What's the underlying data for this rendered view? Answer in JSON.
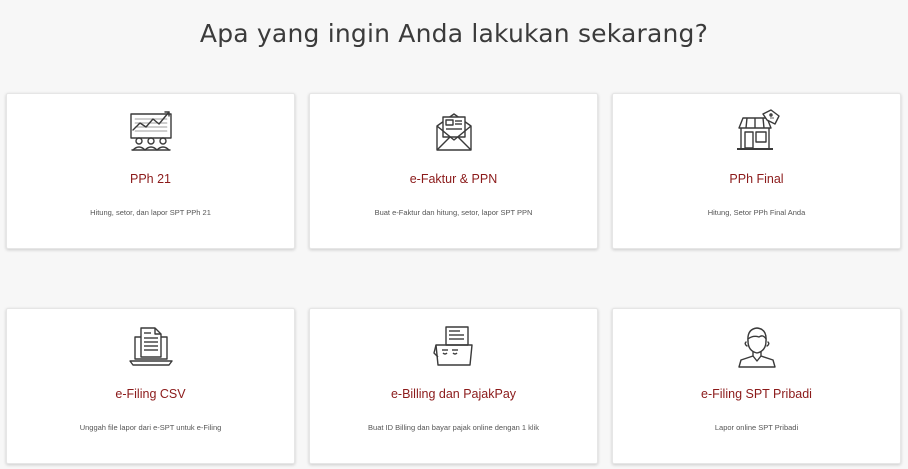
{
  "heading": "Apa yang ingin Anda lakukan sekarang?",
  "colors": {
    "title": "#8b1a1a",
    "icon_stroke": "#3a3a3a",
    "background": "#f7f7f7",
    "card": "#ffffff"
  },
  "cards": [
    {
      "icon": "chart-people-icon",
      "title": "PPh 21",
      "description": "Hitung, setor, dan lapor SPT PPh 21"
    },
    {
      "icon": "envelope-document-icon",
      "title": "e-Faktur & PPN",
      "description": "Buat e-Faktur dan hitung, setor, lapor SPT PPN"
    },
    {
      "icon": "storefront-tag-icon",
      "title": "PPh Final",
      "description": "Hitung, Setor PPh Final Anda"
    },
    {
      "icon": "laptop-document-icon",
      "title": "e-Filing CSV",
      "description": "Unggah file lapor dari e-SPT untuk e-Filing"
    },
    {
      "icon": "receipt-machine-icon",
      "title": "e-Billing dan PajakPay",
      "description": "Buat ID Billing dan bayar pajak online dengan 1 klik"
    },
    {
      "icon": "person-icon",
      "title": "e-Filing SPT Pribadi",
      "description": "Lapor online SPT Pribadi"
    }
  ]
}
